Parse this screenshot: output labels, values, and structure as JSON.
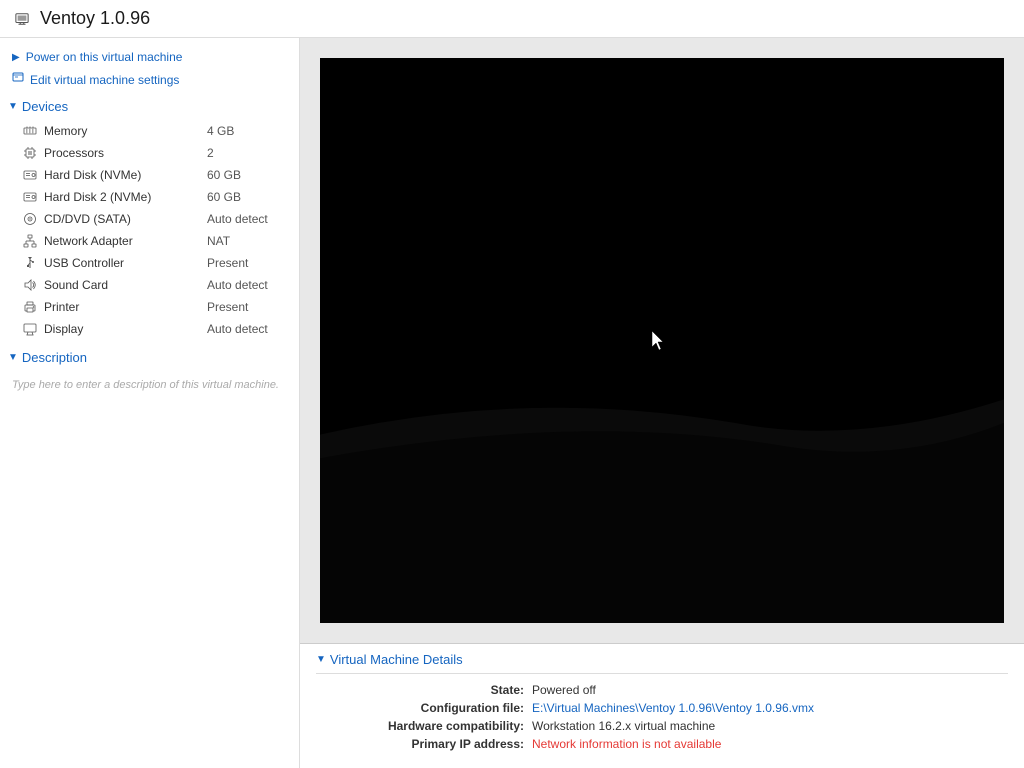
{
  "window": {
    "title": "Ventoy 1.0.96",
    "icon": "vm-icon"
  },
  "actions": {
    "power_on": "Power on this virtual machine",
    "edit_settings": "Edit virtual machine settings"
  },
  "devices_section": {
    "label": "Devices",
    "items": [
      {
        "name": "Memory",
        "value": "4 GB",
        "icon": "memory-icon"
      },
      {
        "name": "Processors",
        "value": "2",
        "icon": "processor-icon"
      },
      {
        "name": "Hard Disk (NVMe)",
        "value": "60 GB",
        "icon": "harddisk-icon"
      },
      {
        "name": "Hard Disk 2 (NVMe)",
        "value": "60 GB",
        "icon": "harddisk-icon"
      },
      {
        "name": "CD/DVD (SATA)",
        "value": "Auto detect",
        "icon": "cdrom-icon"
      },
      {
        "name": "Network Adapter",
        "value": "NAT",
        "icon": "network-icon"
      },
      {
        "name": "USB Controller",
        "value": "Present",
        "icon": "usb-icon"
      },
      {
        "name": "Sound Card",
        "value": "Auto detect",
        "icon": "sound-icon"
      },
      {
        "name": "Printer",
        "value": "Present",
        "icon": "printer-icon"
      },
      {
        "name": "Display",
        "value": "Auto detect",
        "icon": "display-icon"
      }
    ]
  },
  "description_section": {
    "label": "Description",
    "placeholder": "Type here to enter a description of this virtual machine."
  },
  "vm_details": {
    "section_label": "Virtual Machine Details",
    "state_label": "State:",
    "state_value": "Powered off",
    "config_label": "Configuration file:",
    "config_value": "E:\\Virtual Machines\\Ventoy 1.0.96\\Ventoy 1.0.96.vmx",
    "hardware_label": "Hardware compatibility:",
    "hardware_value": "Workstation 16.2.x virtual machine",
    "ip_label": "Primary IP address:",
    "ip_value": "Network information is not available"
  },
  "colors": {
    "accent": "#1565c0",
    "link": "#1565c0",
    "error": "#e53935"
  }
}
